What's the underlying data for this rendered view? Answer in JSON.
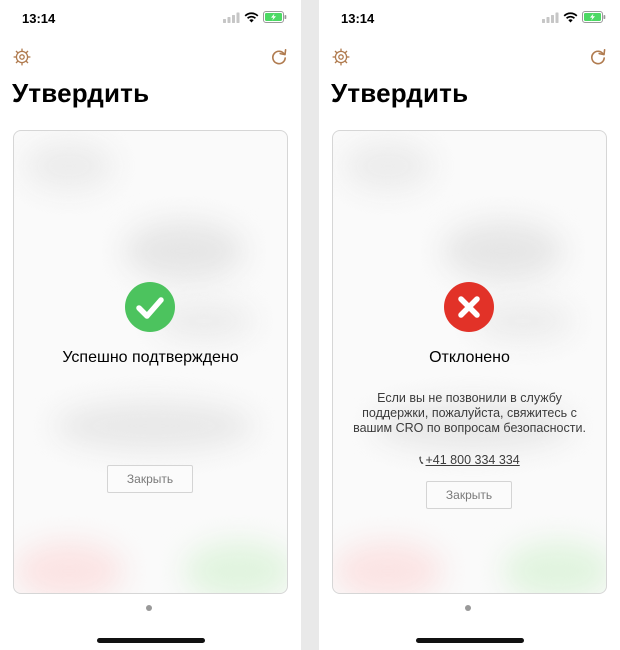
{
  "screens": [
    {
      "status_bar": {
        "time": "13:14"
      },
      "title": "Утвердить",
      "result": {
        "state": "success",
        "text": "Успешно подтверждено"
      },
      "close_label": "Закрыть"
    },
    {
      "status_bar": {
        "time": "13:14"
      },
      "title": "Утвердить",
      "result": {
        "state": "rejected",
        "text": "Отклонено"
      },
      "message": "Если вы не позвонили в службу поддержки, пожалуйста, свяжитесь с вашим CRO по вопросам безопасности.",
      "phone": "+41 800 334 334",
      "close_label": "Закрыть"
    }
  ],
  "icons": {
    "settings": "gear-icon",
    "refresh": "refresh-icon",
    "success": "checkmark-icon",
    "rejected": "cross-icon",
    "phone": "phone-icon"
  },
  "colors": {
    "accent_icons": "#b07b4f",
    "success": "#4cc35e",
    "rejected": "#e23228",
    "battery": "#4cd964"
  }
}
